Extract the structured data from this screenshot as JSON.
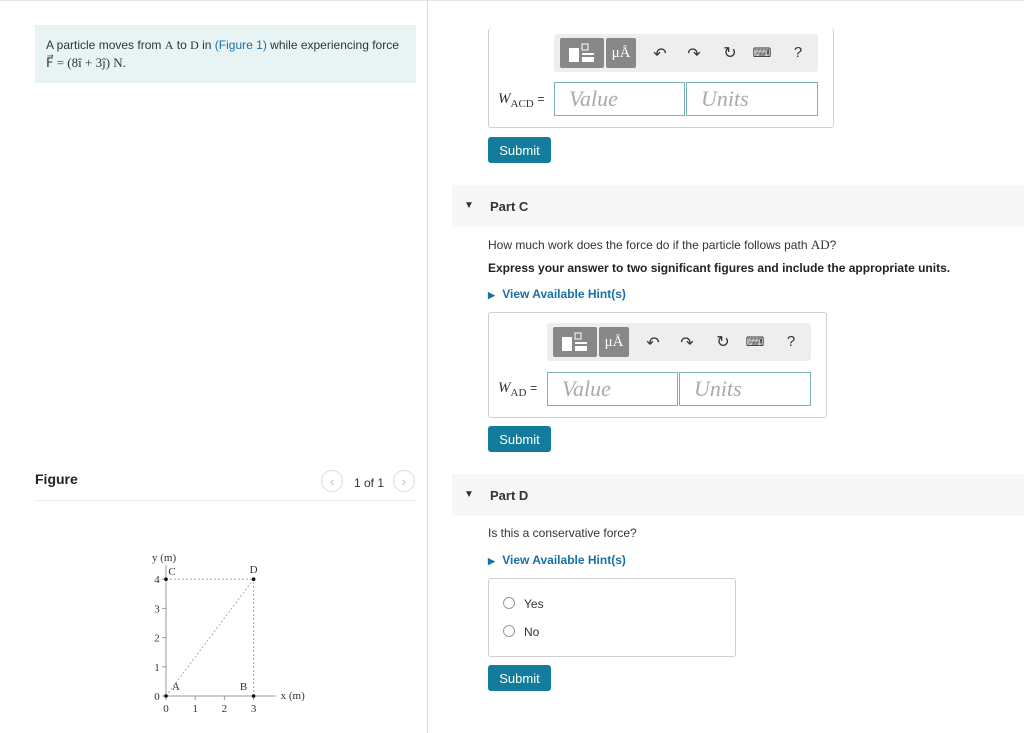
{
  "problem": {
    "intro": "A particle moves from",
    "point_a": "A",
    "to": "to",
    "point_d": "D",
    "in": "in",
    "figure_link": "(Figure 1)",
    "rest": "while experiencing force",
    "force_eq": "F⃗ = (8î + 3ĵ) N."
  },
  "figure": {
    "title": "Figure",
    "pager": "1 of 1",
    "prev_icon": "chevron-left-icon",
    "next_icon": "chevron-right-icon"
  },
  "chart_data": {
    "type": "scatter",
    "xlabel": "x (m)",
    "ylabel": "y (m)",
    "xlim": [
      0,
      3
    ],
    "ylim": [
      0,
      4
    ],
    "x_ticks": [
      "0",
      "1",
      "2",
      "3"
    ],
    "y_ticks": [
      "0",
      "1",
      "2",
      "3",
      "4"
    ],
    "points": [
      {
        "label": "A",
        "x": 0,
        "y": 0
      },
      {
        "label": "B",
        "x": 3,
        "y": 0
      },
      {
        "label": "C",
        "x": 0,
        "y": 4
      },
      {
        "label": "D",
        "x": 3,
        "y": 4
      }
    ]
  },
  "part_b": {
    "label_main": "W",
    "label_sub": "ACD",
    "equals": "=",
    "value_placeholder": "Value",
    "units_placeholder": "Units",
    "submit": "Submit"
  },
  "toolbar": {
    "template_icon": "template-icon",
    "units_label": "μÅ",
    "undo_icon": "undo-icon",
    "redo_icon": "redo-icon",
    "reset_icon": "reset-icon",
    "keyboard_icon": "keyboard-icon",
    "help_label": "?"
  },
  "part_c": {
    "title": "Part C",
    "question_pre": "How much work does the force do if the particle follows path",
    "question_path": "AD",
    "question_post": "?",
    "instruction": "Express your answer to two significant figures and include the appropriate units.",
    "hint": "View Available Hint(s)",
    "label_main": "W",
    "label_sub": "AD",
    "equals": "=",
    "value_placeholder": "Value",
    "units_placeholder": "Units",
    "submit": "Submit"
  },
  "part_d": {
    "title": "Part D",
    "question": "Is this a conservative force?",
    "hint": "View Available Hint(s)",
    "options": [
      "Yes",
      "No"
    ],
    "submit": "Submit"
  }
}
